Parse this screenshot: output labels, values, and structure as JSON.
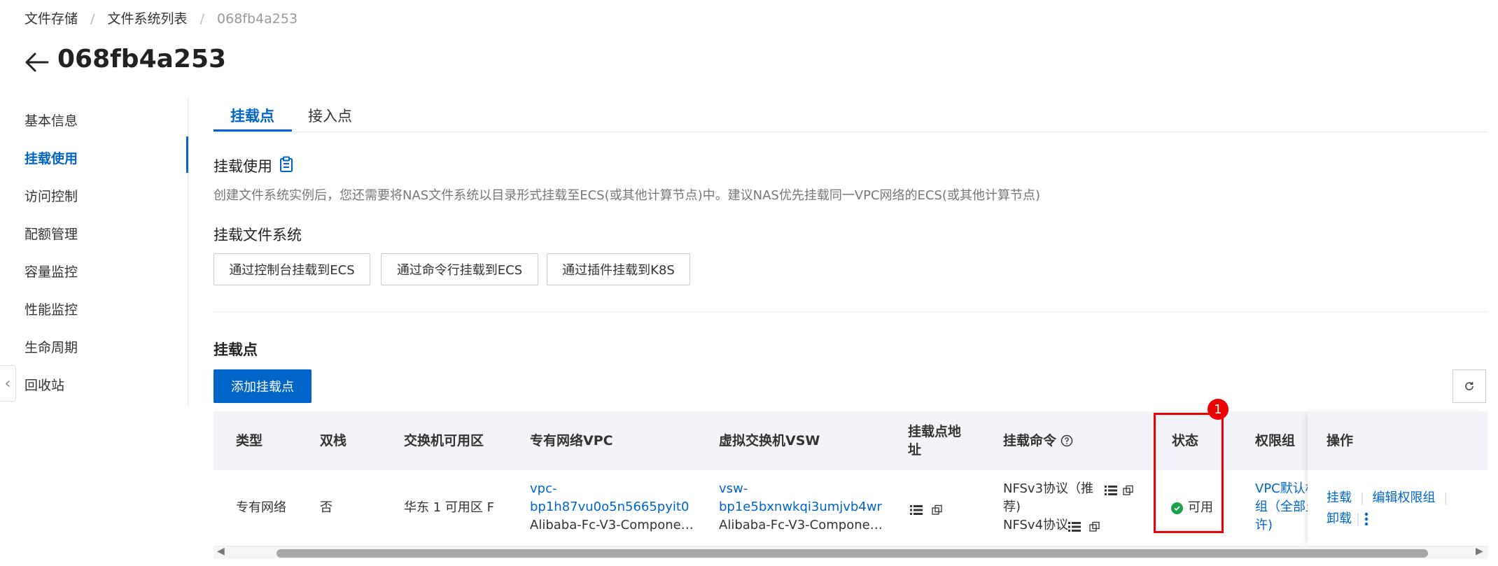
{
  "breadcrumb": {
    "items": [
      "文件存储",
      "文件系统列表",
      "068fb4a253"
    ],
    "separator": "/"
  },
  "page": {
    "title": "068fb4a253"
  },
  "sidebar": {
    "items": [
      {
        "label": "基本信息"
      },
      {
        "label": "挂载使用",
        "active": true
      },
      {
        "label": "访问控制"
      },
      {
        "label": "配额管理"
      },
      {
        "label": "容量监控"
      },
      {
        "label": "性能监控"
      },
      {
        "label": "生命周期"
      },
      {
        "label": "回收站"
      }
    ]
  },
  "tabs": [
    {
      "label": "挂载点",
      "active": true
    },
    {
      "label": "接入点"
    }
  ],
  "usage": {
    "title": "挂载使用",
    "description": "创建文件系统实例后，您还需要将NAS文件系统以目录形式挂载至ECS(或其他计算节点)中。建议NAS优先挂载同一VPC网络的ECS(或其他计算节点)"
  },
  "mount_fs": {
    "title": "挂载文件系统",
    "buttons": [
      "通过控制台挂载到ECS",
      "通过命令行挂载到ECS",
      "通过插件挂载到K8S"
    ]
  },
  "mounts": {
    "title": "挂载点",
    "add_button": "添加挂载点",
    "columns": {
      "type": "类型",
      "dual_stack": "双栈",
      "zone": "交换机可用区",
      "vpc": "专有网络VPC",
      "vsw": "虚拟交换机VSW",
      "address_l1": "挂载点地",
      "address_l2": "址",
      "command": "挂载命令",
      "status": "状态",
      "perm_group": "权限组",
      "ops": "操作"
    },
    "rows": [
      {
        "type": "专有网络",
        "dual_stack": "否",
        "zone": "华东 1 可用区 F",
        "vpc_id_l1": "vpc-",
        "vpc_id_l2": "bp1h87vu0o5n5665pyit0",
        "vpc_name": "Alibaba-Fc-V3-Componen...",
        "vsw_id_l1": "vsw-",
        "vsw_id_l2": "bp1e5bxnwkqi3umjvb4wr",
        "vsw_name": "Alibaba-Fc-V3-Componen...",
        "cmd_nfsv3_l1": "NFSv3协议（推",
        "cmd_nfsv3_l2": "荐)",
        "cmd_nfsv4": "NFSv4协议",
        "status": "可用",
        "perm_l1": "VPC默认权",
        "perm_l2": "组（全部允",
        "perm_l3": "许)",
        "ops": {
          "mount": "挂载",
          "edit_perm": "编辑权限组",
          "unmount": "卸载"
        }
      }
    ]
  },
  "annotation": {
    "marker": "1"
  },
  "colors": {
    "accent": "#0064c8",
    "status_ok": "#1e9f4a",
    "highlight": "#e00000"
  }
}
